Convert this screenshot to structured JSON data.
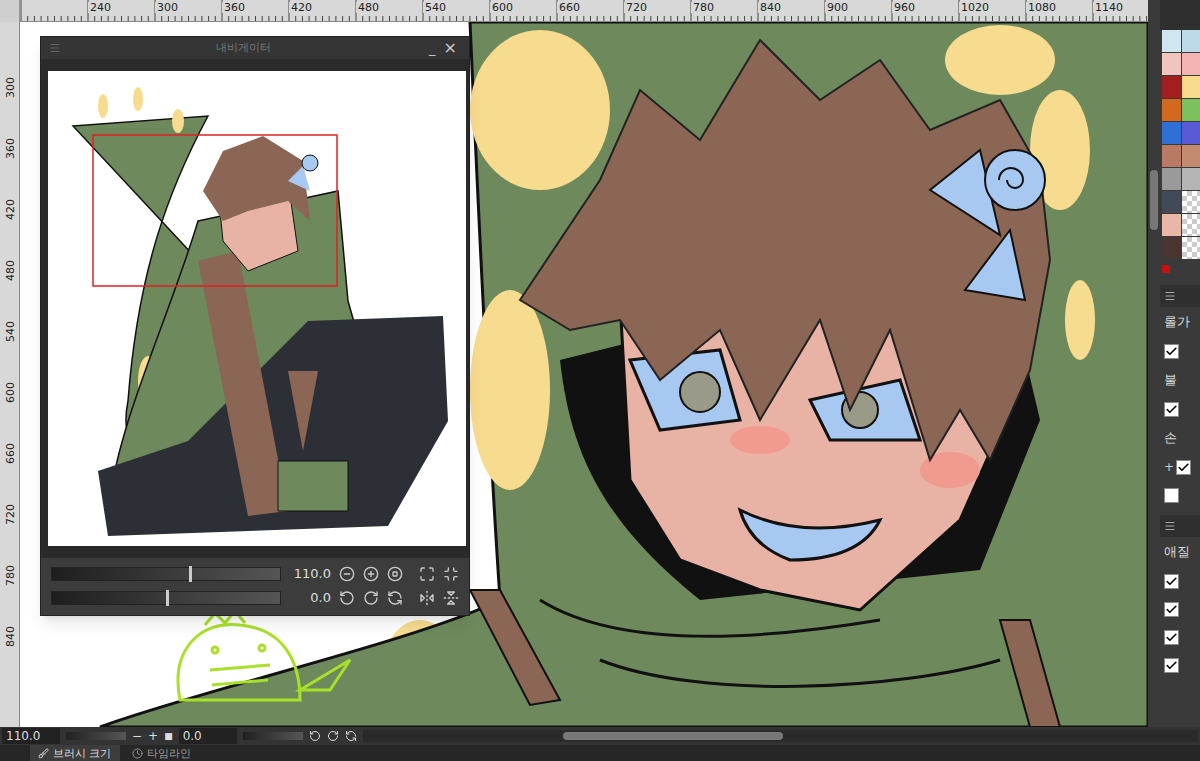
{
  "rulers": {
    "horizontal": [
      "240",
      "300",
      "360",
      "420",
      "480",
      "540",
      "600",
      "660",
      "720",
      "780",
      "840",
      "900",
      "960",
      "1020",
      "1080",
      "1140"
    ],
    "vertical": [
      "300",
      "360",
      "420",
      "480",
      "540",
      "600",
      "660",
      "720",
      "780",
      "840"
    ]
  },
  "navigator": {
    "title": "내비게이터",
    "minimize": "_",
    "close": "×",
    "zoom": "110.0",
    "rotation": "0.0",
    "zoom_level": 0.6,
    "rotation_level": 0.5
  },
  "status_bar": {
    "zoom": "110.0",
    "zoom_minus": "−",
    "zoom_plus": "+",
    "reset": "■",
    "rotation": "0.0"
  },
  "bottom_tabs": [
    {
      "label": "브러시 크기",
      "selected": true
    },
    {
      "label": "타임라인",
      "selected": false
    }
  ],
  "palette": [
    {
      "kind": "color",
      "color": "#cfe8ef"
    },
    {
      "kind": "color",
      "color": "#bcd9e8"
    },
    {
      "kind": "color",
      "color": "#f2c4c0"
    },
    {
      "kind": "color",
      "color": "#f4b4b4"
    },
    {
      "kind": "color",
      "color": "#a02020"
    },
    {
      "kind": "color",
      "color": "#f7dc8f"
    },
    {
      "kind": "color",
      "color": "#d2691e"
    },
    {
      "kind": "color",
      "color": "#7cc060"
    },
    {
      "kind": "color",
      "color": "#2f6fd6"
    },
    {
      "kind": "color",
      "color": "#5a5ad6"
    },
    {
      "kind": "color",
      "color": "#b87a62"
    },
    {
      "kind": "color",
      "color": "#c38b70"
    },
    {
      "kind": "color",
      "color": "#9a9a9a"
    },
    {
      "kind": "color",
      "color": "#b5b5b5"
    },
    {
      "kind": "color",
      "color": "#444a55"
    },
    {
      "kind": "transparent",
      "color": "#ffffff"
    },
    {
      "kind": "color",
      "color": "#e8b7a8"
    },
    {
      "kind": "transparent",
      "color": "#ffffff"
    },
    {
      "kind": "color",
      "color": "#4a3630"
    },
    {
      "kind": "transparent",
      "color": "#ffffff"
    }
  ],
  "side_panel": [
    {
      "kind": "header"
    },
    {
      "kind": "label",
      "label": "롤가"
    },
    {
      "kind": "checkbox",
      "checked": true
    },
    {
      "kind": "label",
      "label": "불"
    },
    {
      "kind": "checkbox",
      "checked": true
    },
    {
      "kind": "label",
      "label": "손"
    },
    {
      "kind": "checkbox",
      "checked": true,
      "prefix": "+"
    },
    {
      "kind": "checkbox",
      "checked": false
    },
    {
      "kind": "header"
    },
    {
      "kind": "label",
      "label": "애질"
    },
    {
      "kind": "checkbox",
      "checked": true
    },
    {
      "kind": "checkbox",
      "checked": true
    },
    {
      "kind": "checkbox",
      "checked": true
    },
    {
      "kind": "checkbox",
      "checked": true
    }
  ]
}
